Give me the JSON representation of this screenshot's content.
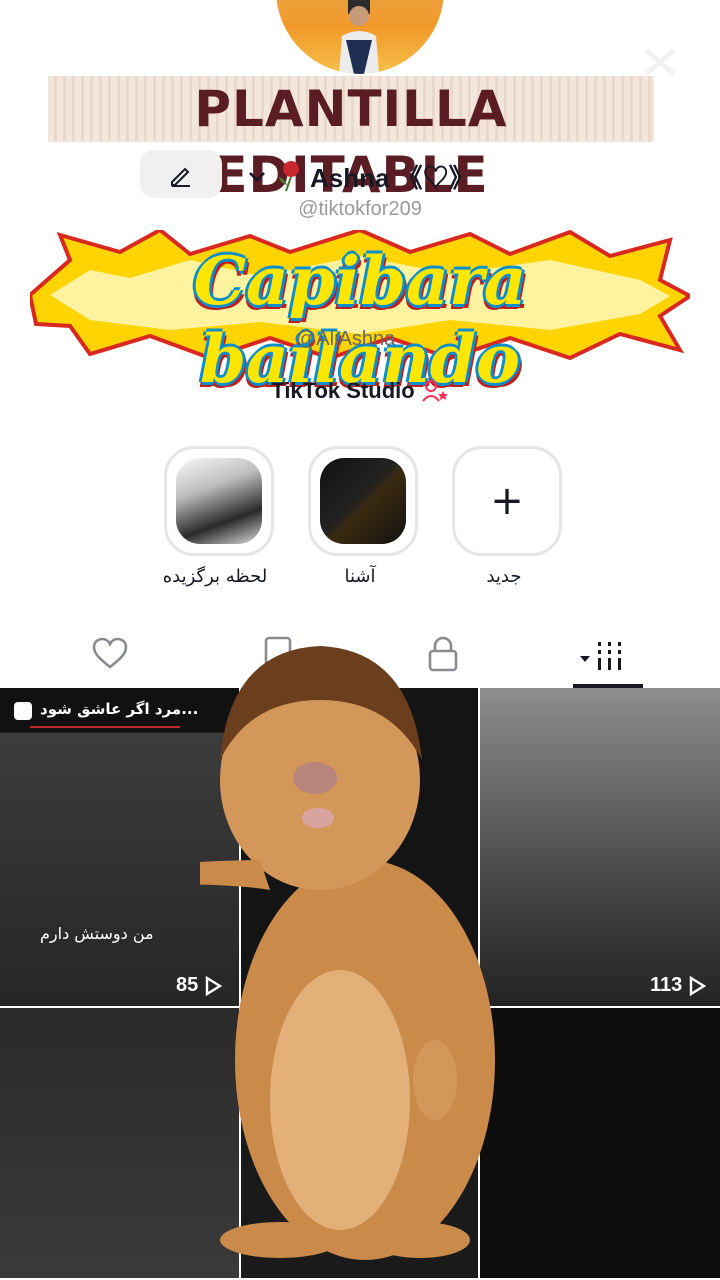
{
  "overlay": {
    "template_banner": "PLANTILLA EDITABLE",
    "sticker_text": "Capibara bailando"
  },
  "profile": {
    "display_name": "Ashna 《♡》",
    "handle": "@tiktokfor209",
    "secondary_handle": "@AliAshna",
    "studio_label": "TikTok Studio"
  },
  "highlights": [
    {
      "label": "لحظه برگزیده",
      "icon": "photo-thumbnail"
    },
    {
      "label": "آشنا",
      "icon": "photo-thumbnail"
    },
    {
      "label": "جدید",
      "icon": "plus-icon"
    }
  ],
  "tabs": [
    {
      "icon": "heart-icon"
    },
    {
      "icon": "bookmark-icon"
    },
    {
      "icon": "lock-icon"
    },
    {
      "icon": "videos-grid-icon",
      "active": true
    }
  ],
  "videos": [
    {
      "title": "مرد اگر عاشق شود...",
      "caption": "من دوستش دارم",
      "views": "85"
    },
    {
      "title": "",
      "caption": "",
      "views": ""
    },
    {
      "title": "",
      "caption": "",
      "views": "113"
    },
    {
      "title": "",
      "caption": "",
      "views": ""
    },
    {
      "title": "",
      "caption": "",
      "views": ""
    },
    {
      "title": "",
      "caption": "",
      "views": ""
    }
  ],
  "colors": {
    "text_primary": "#161823",
    "handle_gray": "#9a9a9a",
    "studio_accent": "#fe2c55",
    "banner_text": "#5a1d24"
  }
}
